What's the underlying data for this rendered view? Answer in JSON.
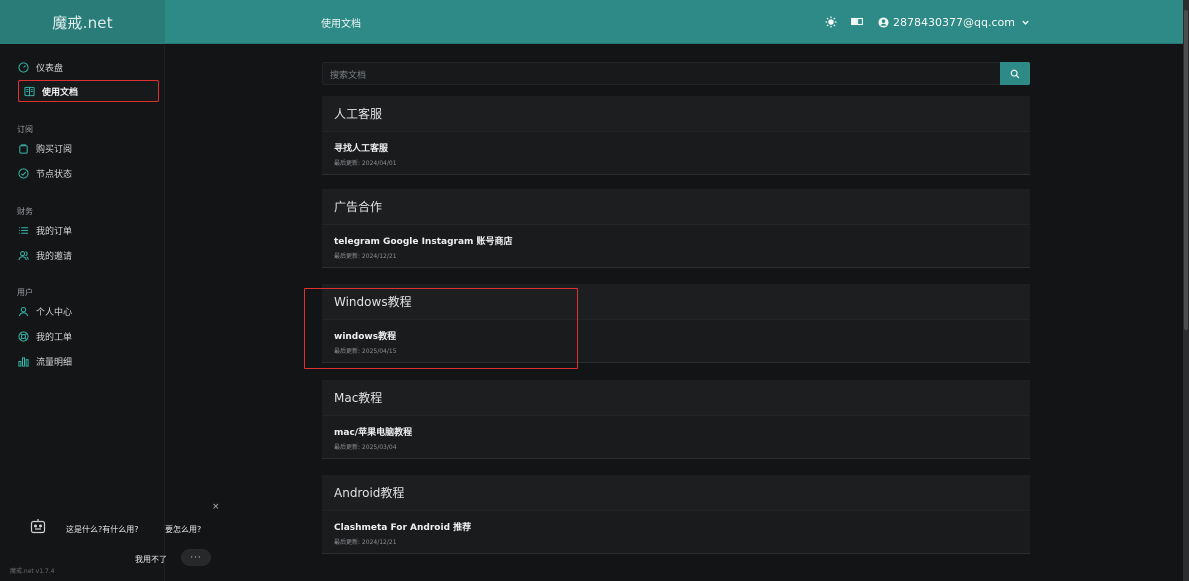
{
  "header": {
    "brand": "魔戒.net",
    "title": "使用文档",
    "user_email": "2878430377@qq.com"
  },
  "sidebar": {
    "items": [
      {
        "label": "仪表盘",
        "icon": "dashboard-gauge-icon"
      },
      {
        "label": "使用文档",
        "icon": "book-icon",
        "active": true
      }
    ],
    "sections": [
      {
        "title": "订阅",
        "items": [
          {
            "label": "购买订阅",
            "icon": "shopping-bag-icon"
          },
          {
            "label": "节点状态",
            "icon": "check-circle-icon"
          }
        ]
      },
      {
        "title": "财务",
        "items": [
          {
            "label": "我的订单",
            "icon": "list-icon"
          },
          {
            "label": "我的邀请",
            "icon": "users-icon"
          }
        ]
      },
      {
        "title": "用户",
        "items": [
          {
            "label": "个人中心",
            "icon": "user-icon"
          },
          {
            "label": "我的工单",
            "icon": "support-ring-icon"
          },
          {
            "label": "流量明细",
            "icon": "bar-chart-icon"
          }
        ]
      }
    ],
    "version": "魔戒.net v1.7.4"
  },
  "helper": {
    "q1": "这是什么?有什么用?",
    "q2": "要怎么用?",
    "cant": "我用不了",
    "more": "···",
    "close": "×"
  },
  "search": {
    "placeholder": "搜索文档"
  },
  "categories": [
    {
      "name": "人工客服",
      "doc": {
        "title": "寻找人工客服",
        "updated": "最后更新: 2024/04/01"
      }
    },
    {
      "name": "广告合作",
      "doc": {
        "title": "telegram Google Instagram 账号商店",
        "updated": "最后更新: 2024/12/21"
      }
    },
    {
      "name": "Windows教程",
      "doc": {
        "title": "windows教程",
        "updated": "最后更新: 2025/04/15"
      }
    },
    {
      "name": "Mac教程",
      "doc": {
        "title": "mac/苹果电脑教程",
        "updated": "最后更新: 2025/03/04"
      }
    },
    {
      "name": "Android教程",
      "doc": {
        "title": "Clashmeta For Android 推荐",
        "updated": "最后更新: 2024/12/21"
      }
    }
  ],
  "colors": {
    "accent": "#2e8a86",
    "highlight": "#e03131",
    "bg": "#131415"
  }
}
